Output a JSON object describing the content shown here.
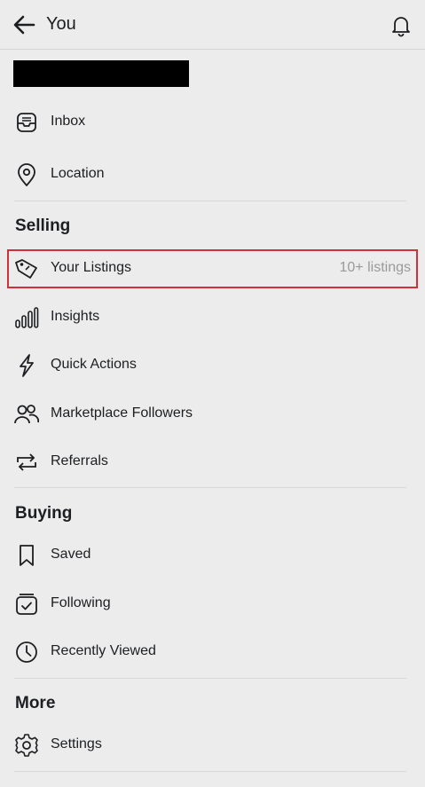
{
  "header": {
    "title": "You",
    "back_icon": "arrow-left-icon",
    "notification_icon": "bell-icon"
  },
  "account": {
    "items": [
      {
        "label": "Inbox",
        "icon": "inbox-icon"
      },
      {
        "label": "Location",
        "icon": "location-pin-icon"
      }
    ]
  },
  "selling": {
    "title": "Selling",
    "items": [
      {
        "label": "Your Listings",
        "meta": "10+ listings",
        "icon": "tag-icon"
      },
      {
        "label": "Insights",
        "icon": "bar-chart-icon"
      },
      {
        "label": "Quick Actions",
        "icon": "lightning-icon"
      },
      {
        "label": "Marketplace Followers",
        "icon": "people-icon"
      },
      {
        "label": "Referrals",
        "icon": "repeat-icon"
      }
    ]
  },
  "buying": {
    "title": "Buying",
    "items": [
      {
        "label": "Saved",
        "icon": "bookmark-icon"
      },
      {
        "label": "Following",
        "icon": "calendar-check-icon"
      },
      {
        "label": "Recently Viewed",
        "icon": "clock-icon"
      }
    ]
  },
  "more": {
    "title": "More",
    "items": [
      {
        "label": "Settings",
        "icon": "gear-icon"
      }
    ]
  },
  "colors": {
    "background": "#ececec",
    "text": "#1c1e21",
    "muted": "#9a9a9a",
    "highlight": "#d32f3a"
  }
}
